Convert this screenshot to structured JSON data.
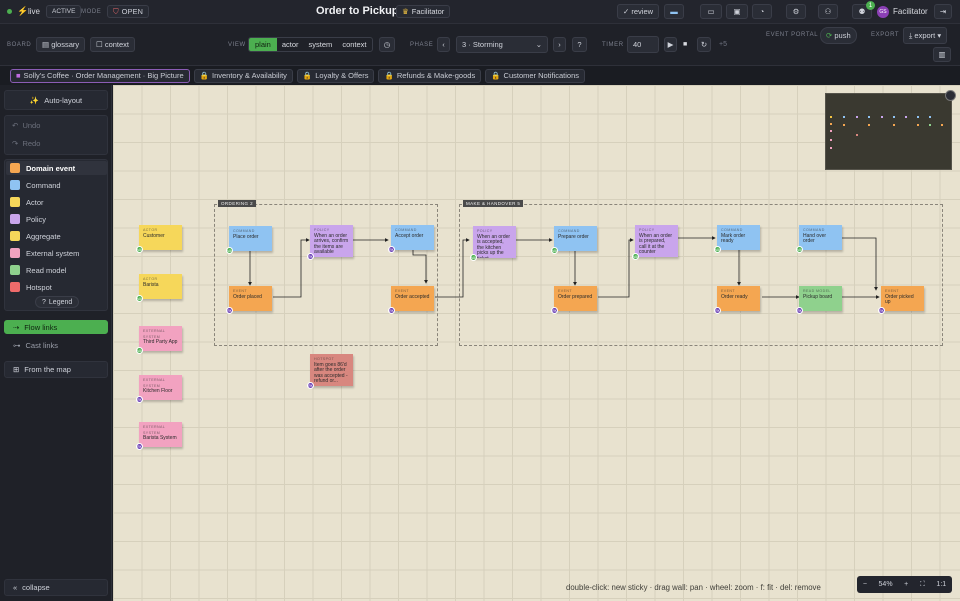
{
  "topbar": {
    "live": "live",
    "active": "ACTIVE",
    "mode_label": "MODE",
    "open": "OPEN",
    "title": "Order to Pickup",
    "facilitator_badge": "Facilitator",
    "review": "review",
    "notif_count": "1",
    "user_initials": "GS",
    "user_name": "Facilitator"
  },
  "subbar": {
    "board_label": "BOARD",
    "glossary": "glossary",
    "context": "context",
    "view_label": "VIEW",
    "views": [
      "plain",
      "actor",
      "system",
      "context"
    ],
    "phase_label": "PHASE",
    "phase_value": "3 · Storming",
    "phase_help": "?",
    "timer_label": "TIMER",
    "timer_value": "40",
    "timer_extra": "+5",
    "event_portal_label": "EVENT PORTAL",
    "push": "push",
    "export_label": "EXPORT",
    "export": "export"
  },
  "tabs": [
    {
      "label": "Solly's Coffee · Order Management · Big Picture",
      "active": true
    },
    {
      "label": "Inventory & Availability"
    },
    {
      "label": "Loyalty & Offers"
    },
    {
      "label": "Refunds & Make-goods"
    },
    {
      "label": "Customer Notifications"
    }
  ],
  "sidebar": {
    "autolayout": "Auto-layout",
    "undo": "Undo",
    "redo": "Redo",
    "legend": [
      {
        "label": "Domain event",
        "color": "#f4a651"
      },
      {
        "label": "Command",
        "color": "#8fc3f2"
      },
      {
        "label": "Actor",
        "color": "#f6d75a"
      },
      {
        "label": "Policy",
        "color": "#c9a5ec"
      },
      {
        "label": "Aggregate",
        "color": "#f6d75a"
      },
      {
        "label": "External system",
        "color": "#f2a2c0"
      },
      {
        "label": "Read model",
        "color": "#8fd18d"
      },
      {
        "label": "Hotspot",
        "color": "#ef6b6b"
      }
    ],
    "legend_btn": "Legend",
    "flow_links": "Flow links",
    "cast_links": "Cast links",
    "from_map": "From the map",
    "collapse": "collapse"
  },
  "groups": [
    {
      "label": "ORDERING 2"
    },
    {
      "label": "MAKE & HANDOVER 5"
    }
  ],
  "stickies": [
    {
      "kind": "ACTOR",
      "text": "Customer",
      "cls": "c-act",
      "av": "MA",
      "avc": "#4caf50"
    },
    {
      "kind": "ACTOR",
      "text": "Barista",
      "cls": "c-act",
      "av": "MA",
      "avc": "#4caf50"
    },
    {
      "kind": "EXTERNAL SYSTEM",
      "text": "Third Party App",
      "cls": "c-ext",
      "av": "MA",
      "avc": "#4caf50"
    },
    {
      "kind": "EXTERNAL SYSTEM",
      "text": "Kitchen Floor",
      "cls": "c-ext",
      "av": "RK",
      "avc": "#6a3fb5"
    },
    {
      "kind": "EXTERNAL SYSTEM",
      "text": "Barista System",
      "cls": "c-ext",
      "av": "RK",
      "avc": "#6a3fb5"
    },
    {
      "kind": "COMMAND",
      "text": "Place order",
      "cls": "c-cmd",
      "av": "MA",
      "avc": "#4caf50"
    },
    {
      "kind": "EVENT",
      "text": "Order placed",
      "cls": "c-evt",
      "av": "RK",
      "avc": "#6a3fb5"
    },
    {
      "kind": "POLICY",
      "text": "When an order arrives, confirm the items are available",
      "cls": "c-pol",
      "av": "RK",
      "avc": "#6a3fb5"
    },
    {
      "kind": "COMMAND",
      "text": "Accept order",
      "cls": "c-cmd",
      "av": "RK",
      "avc": "#6a3fb5"
    },
    {
      "kind": "EVENT",
      "text": "Order accepted",
      "cls": "c-evt",
      "av": "RK",
      "avc": "#6a3fb5"
    },
    {
      "kind": "HOTSPOT",
      "text": "Item goes 86'd after the order was accepted - refund or...",
      "cls": "c-hot",
      "av": "RK",
      "avc": "#6a3fb5"
    },
    {
      "kind": "POLICY",
      "text": "When an order is accepted, the kitchen picks up the ticket",
      "cls": "c-pol",
      "av": "MA",
      "avc": "#4caf50"
    },
    {
      "kind": "COMMAND",
      "text": "Prepare order",
      "cls": "c-cmd",
      "av": "MA",
      "avc": "#4caf50"
    },
    {
      "kind": "EVENT",
      "text": "Order prepared",
      "cls": "c-evt",
      "av": "RK",
      "avc": "#6a3fb5"
    },
    {
      "kind": "POLICY",
      "text": "When an order is prepared, call it at the counter",
      "cls": "c-pol",
      "av": "MA",
      "avc": "#4caf50"
    },
    {
      "kind": "COMMAND",
      "text": "Mark order ready",
      "cls": "c-cmd",
      "av": "MA",
      "avc": "#4caf50"
    },
    {
      "kind": "EVENT",
      "text": "Order ready",
      "cls": "c-evt",
      "av": "RK",
      "avc": "#6a3fb5"
    },
    {
      "kind": "READ MODEL",
      "text": "Pickup board",
      "cls": "c-read",
      "av": "RK",
      "avc": "#6a3fb5"
    },
    {
      "kind": "COMMAND",
      "text": "Hand over order",
      "cls": "c-cmd",
      "av": "MA",
      "avc": "#4caf50"
    },
    {
      "kind": "EVENT",
      "text": "Order picked up",
      "cls": "c-evt",
      "av": "RK",
      "avc": "#6a3fb5"
    }
  ],
  "canvas": {
    "hint": "double-click: new sticky · drag wall: pan · wheel: zoom · f: fit · del: remove",
    "zoom": "54%",
    "zoom_minus": "−",
    "zoom_plus": "+",
    "one_to_one": "1:1"
  }
}
